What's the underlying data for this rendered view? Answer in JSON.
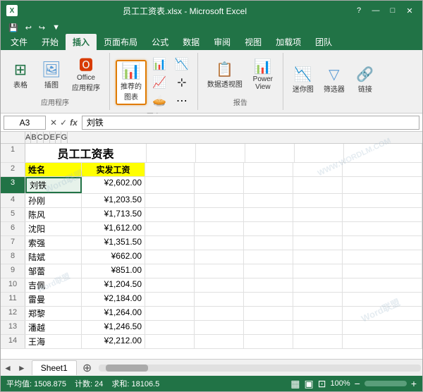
{
  "titleBar": {
    "title": "员工工资表.xlsx - Microsoft Excel",
    "helpBtn": "?",
    "minBtn": "—",
    "maxBtn": "□",
    "closeBtn": "✕"
  },
  "quickAccess": {
    "save": "💾",
    "undo": "↩",
    "redo": "↪",
    "customBtn": "▼"
  },
  "ribbonTabs": [
    "文件",
    "开始",
    "插入",
    "页面布局",
    "公式",
    "数据",
    "审阅",
    "视图",
    "加载项",
    "团队"
  ],
  "activeTab": "插入",
  "ribbonGroups": [
    {
      "label": "应用程序",
      "buttons": [
        {
          "id": "table-btn",
          "icon": "⊞",
          "label": "表格",
          "color": "#217346"
        },
        {
          "id": "picture-btn",
          "icon": "🖼",
          "label": "插图",
          "color": "#5b9bd5"
        },
        {
          "id": "office-btn",
          "icon": "🅾",
          "label": "Office\n应用程序",
          "color": "#d83b01",
          "active": false
        }
      ]
    },
    {
      "label": "图表",
      "buttons": [
        {
          "id": "recommend-chart-btn",
          "icon": "📊",
          "label": "推荐的\n图表",
          "color": "#e07b00",
          "active": true
        },
        {
          "id": "bar-chart-btn",
          "icon": "📈",
          "label": "",
          "color": "#555"
        },
        {
          "id": "line-chart-btn",
          "icon": "📉",
          "label": "",
          "color": "#555"
        },
        {
          "id": "pie-chart-btn",
          "icon": "🥧",
          "label": "",
          "color": "#555"
        },
        {
          "id": "more-chart-btn",
          "icon": "⋯",
          "label": "",
          "color": "#555"
        }
      ]
    },
    {
      "label": "报告",
      "buttons": [
        {
          "id": "pivot-chart-btn",
          "icon": "📋",
          "label": "数据透视图",
          "color": "#217346"
        },
        {
          "id": "power-view-btn",
          "icon": "📊",
          "label": "Power\nView",
          "color": "#5b9bd5"
        }
      ]
    },
    {
      "label": "",
      "buttons": [
        {
          "id": "sparkline-btn",
          "icon": "📉",
          "label": "迷你图",
          "color": "#333"
        },
        {
          "id": "filter-btn",
          "icon": "🔽",
          "label": "筛选器",
          "color": "#5b9bd5"
        },
        {
          "id": "link-btn",
          "icon": "🔗",
          "label": "链接",
          "color": "#5b9bd5"
        }
      ]
    }
  ],
  "formulaBar": {
    "cellRef": "A3",
    "cancelIcon": "✕",
    "confirmIcon": "✓",
    "functionIcon": "fx",
    "formula": "刘铁"
  },
  "columns": [
    "A",
    "B",
    "C",
    "D",
    "E",
    "F",
    "G"
  ],
  "rows": [
    {
      "num": "1",
      "cells": [
        "员工工资表",
        "",
        "",
        "",
        "",
        "",
        ""
      ],
      "merged": true
    },
    {
      "num": "2",
      "cells": [
        "姓名",
        "实发工资",
        "",
        "",
        "",
        "",
        ""
      ]
    },
    {
      "num": "3",
      "cells": [
        "刘铁",
        "¥2,602.00",
        "",
        "",
        "",
        "",
        ""
      ],
      "selected": true
    },
    {
      "num": "4",
      "cells": [
        "孙刚",
        "¥1,203.50",
        "",
        "",
        "",
        "",
        ""
      ]
    },
    {
      "num": "5",
      "cells": [
        "陈风",
        "¥1,713.50",
        "",
        "",
        "",
        "",
        ""
      ]
    },
    {
      "num": "6",
      "cells": [
        "沈阳",
        "¥1,612.00",
        "",
        "",
        "",
        "",
        ""
      ]
    },
    {
      "num": "7",
      "cells": [
        "索强",
        "¥1,351.50",
        "",
        "",
        "",
        "",
        ""
      ]
    },
    {
      "num": "8",
      "cells": [
        "陆斌",
        "¥662.00",
        "",
        "",
        "",
        "",
        ""
      ]
    },
    {
      "num": "9",
      "cells": [
        "邹蕾",
        "¥851.00",
        "",
        "",
        "",
        "",
        ""
      ]
    },
    {
      "num": "10",
      "cells": [
        "吉佩",
        "¥1,204.50",
        "",
        "",
        "",
        "",
        ""
      ]
    },
    {
      "num": "11",
      "cells": [
        "雷曼",
        "¥2,184.00",
        "",
        "",
        "",
        "",
        ""
      ]
    },
    {
      "num": "12",
      "cells": [
        "郑黎",
        "¥1,264.00",
        "",
        "",
        "",
        "",
        ""
      ]
    },
    {
      "num": "13",
      "cells": [
        "潘越",
        "¥1,246.50",
        "",
        "",
        "",
        "",
        ""
      ]
    },
    {
      "num": "14",
      "cells": [
        "王海",
        "¥2,212.00",
        "",
        "",
        "",
        "",
        ""
      ]
    }
  ],
  "sheetTabs": [
    "Sheet1"
  ],
  "statusBar": {
    "avg": "平均值: 1508.875",
    "count": "计数: 24",
    "sum": "求和: 18106.5"
  },
  "watermarks": [
    "Word联盟",
    "WWW.WORDLM.COM"
  ]
}
